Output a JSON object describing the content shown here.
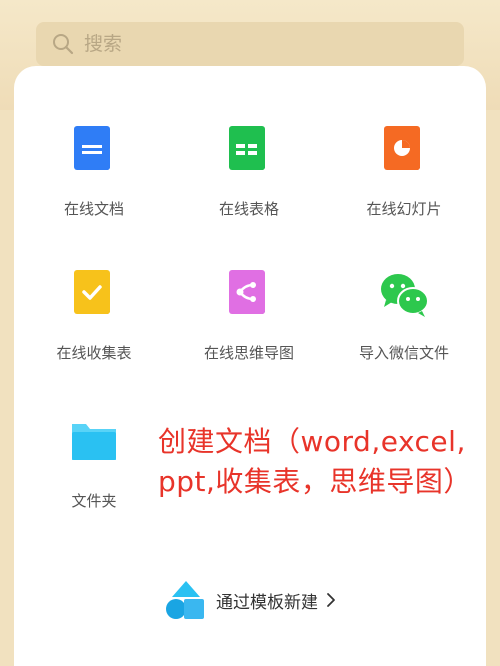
{
  "search": {
    "placeholder": "搜索"
  },
  "grid": [
    {
      "label": "在线文档",
      "icon": "doc-icon",
      "color": "#2f7df6"
    },
    {
      "label": "在线表格",
      "icon": "sheet-icon",
      "color": "#1fbf4f"
    },
    {
      "label": "在线幻灯片",
      "icon": "slides-icon",
      "color": "#f56a23"
    },
    {
      "label": "在线收集表",
      "icon": "form-icon",
      "color": "#f7c21b"
    },
    {
      "label": "在线思维导图",
      "icon": "mindmap-icon",
      "color": "#e06fe3"
    },
    {
      "label": "导入微信文件",
      "icon": "wechat-icon",
      "color": "#2dc84d"
    },
    {
      "label": "文件夹",
      "icon": "folder-icon",
      "color": "#2ac1f2"
    }
  ],
  "annotation": {
    "line1": "创建文档（word,excel,",
    "line2": "ppt,收集表，思维导图）"
  },
  "template": {
    "label": "通过模板新建",
    "icon": "template-shapes-icon"
  }
}
